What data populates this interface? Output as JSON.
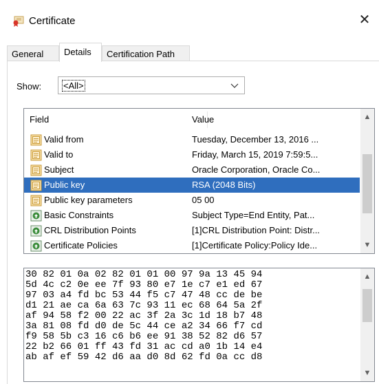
{
  "window": {
    "title": "Certificate",
    "close_glyph": "✕"
  },
  "tabs": [
    {
      "label": "General",
      "active": false
    },
    {
      "label": "Details",
      "active": true
    },
    {
      "label": "Certification Path",
      "active": false
    }
  ],
  "show": {
    "label": "Show:",
    "value": "<All>"
  },
  "fields_table": {
    "columns": {
      "field": "Field",
      "value": "Value"
    },
    "rows": [
      {
        "field": "Valid from",
        "value": "Tuesday, December 13, 2016 ...",
        "icon": "property-icon"
      },
      {
        "field": "Valid to",
        "value": "Friday, March 15, 2019 7:59:5...",
        "icon": "property-icon"
      },
      {
        "field": "Subject",
        "value": "Oracle Corporation, Oracle Co...",
        "icon": "property-icon"
      },
      {
        "field": "Public key",
        "value": "RSA (2048 Bits)",
        "icon": "property-icon",
        "selected": true
      },
      {
        "field": "Public key parameters",
        "value": "05 00",
        "icon": "property-icon"
      },
      {
        "field": "Basic Constraints",
        "value": "Subject Type=End Entity, Pat...",
        "icon": "extension-icon"
      },
      {
        "field": "CRL Distribution Points",
        "value": "[1]CRL Distribution Point: Distr...",
        "icon": "extension-icon"
      },
      {
        "field": "Certificate Policies",
        "value": "[1]Certificate Policy:Policy Ide...",
        "icon": "extension-icon"
      }
    ]
  },
  "hex_lines": [
    "30 82 01 0a 02 82 01 01 00 97 9a 13 45 94",
    "5d 4c c2 0e ee 7f 93 80 e7 1e c7 e1 ed 67",
    "97 03 a4 fd bc 53 44 f5 c7 47 48 cc de be",
    "d1 21 ae ca 6a 63 7c 93 11 ec 68 64 5a 2f",
    "af 94 58 f2 00 22 ac 3f 2a 3c 1d 18 b7 48",
    "3a 81 08 fd d0 de 5c 44 ce a2 34 66 f7 cd",
    "f9 58 5b c3 16 c6 b6 ee 91 38 52 82 d6 57",
    "22 b2 66 01 ff 43 fd 31 ac cd a0 1b 14 e4",
    "ab af ef 59 42 d6 aa d0 8d 62 fd 0a cc d8"
  ],
  "colors": {
    "selection": "#2f6ebe",
    "border": "#828790"
  }
}
